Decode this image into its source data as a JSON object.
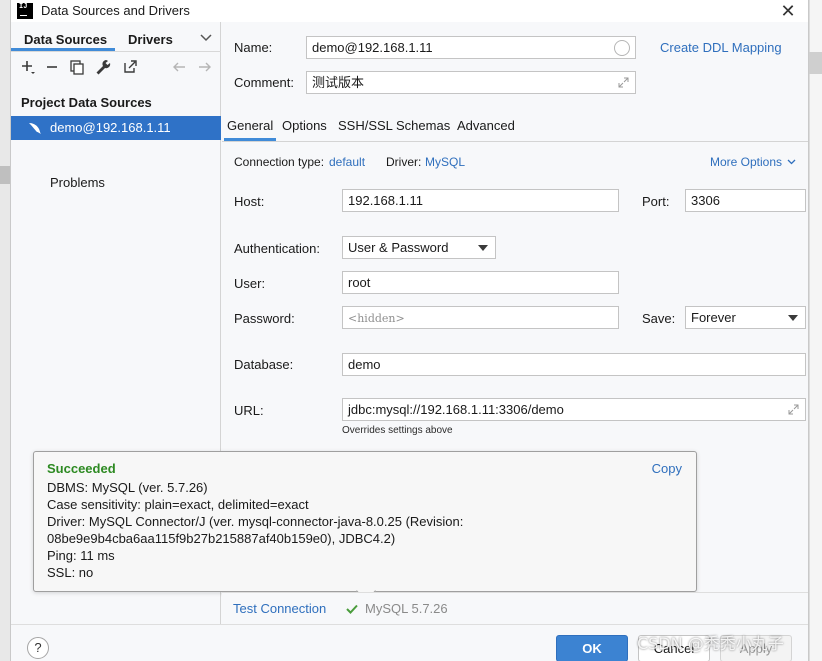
{
  "window": {
    "title": "Data Sources and Drivers",
    "app_icon_text": "IJ"
  },
  "sidebar": {
    "tabs": [
      {
        "label": "Data Sources"
      },
      {
        "label": "Drivers"
      }
    ],
    "section_title": "Project Data Sources",
    "datasource": {
      "label": "demo@192.168.1.11"
    },
    "problems_label": "Problems"
  },
  "form": {
    "name_label": "Name:",
    "name_value": "demo@192.168.1.11",
    "create_ddl_link": "Create DDL Mapping",
    "comment_label": "Comment:",
    "comment_value": "测试版本"
  },
  "tabs": [
    {
      "label": "General"
    },
    {
      "label": "Options"
    },
    {
      "label": "SSH/SSL"
    },
    {
      "label": "Schemas"
    },
    {
      "label": "Advanced"
    }
  ],
  "general": {
    "connection_type_label": "Connection type:",
    "connection_type_value": "default",
    "driver_label": "Driver:",
    "driver_value": "MySQL",
    "more_options": "More Options",
    "host_label": "Host:",
    "host_value": "192.168.1.11",
    "port_label": "Port:",
    "port_value": "3306",
    "auth_label": "Authentication:",
    "auth_value": "User & Password",
    "user_label": "User:",
    "user_value": "root",
    "password_label": "Password:",
    "password_placeholder": "<hidden>",
    "save_label": "Save:",
    "save_value": "Forever",
    "database_label": "Database:",
    "database_value": "demo",
    "url_label": "URL:",
    "url_value": "jdbc:mysql://192.168.1.11:3306/demo",
    "url_hint": "Overrides settings above"
  },
  "popup": {
    "status": "Succeeded",
    "copy": "Copy",
    "lines": [
      "DBMS: MySQL (ver. 5.7.26)",
      "Case sensitivity: plain=exact, delimited=exact",
      "Driver: MySQL Connector/J (ver. mysql-connector-java-8.0.25 (Revision:",
      "08be9e9b4cba6aa115f9b27b215887af40b159e0), JDBC4.2)",
      "Ping: 11 ms",
      "SSL: no"
    ]
  },
  "test_row": {
    "test_connection": "Test Connection",
    "result": "MySQL 5.7.26"
  },
  "footer": {
    "help": "?",
    "ok": "OK",
    "cancel": "Cancel",
    "apply": "Apply"
  },
  "watermark": "CSDN @秃秃小丸子",
  "colors": {
    "accent": "#408bd8",
    "selection": "#2f72c7",
    "link": "#2f6fbd",
    "success": "#2d8a22"
  }
}
